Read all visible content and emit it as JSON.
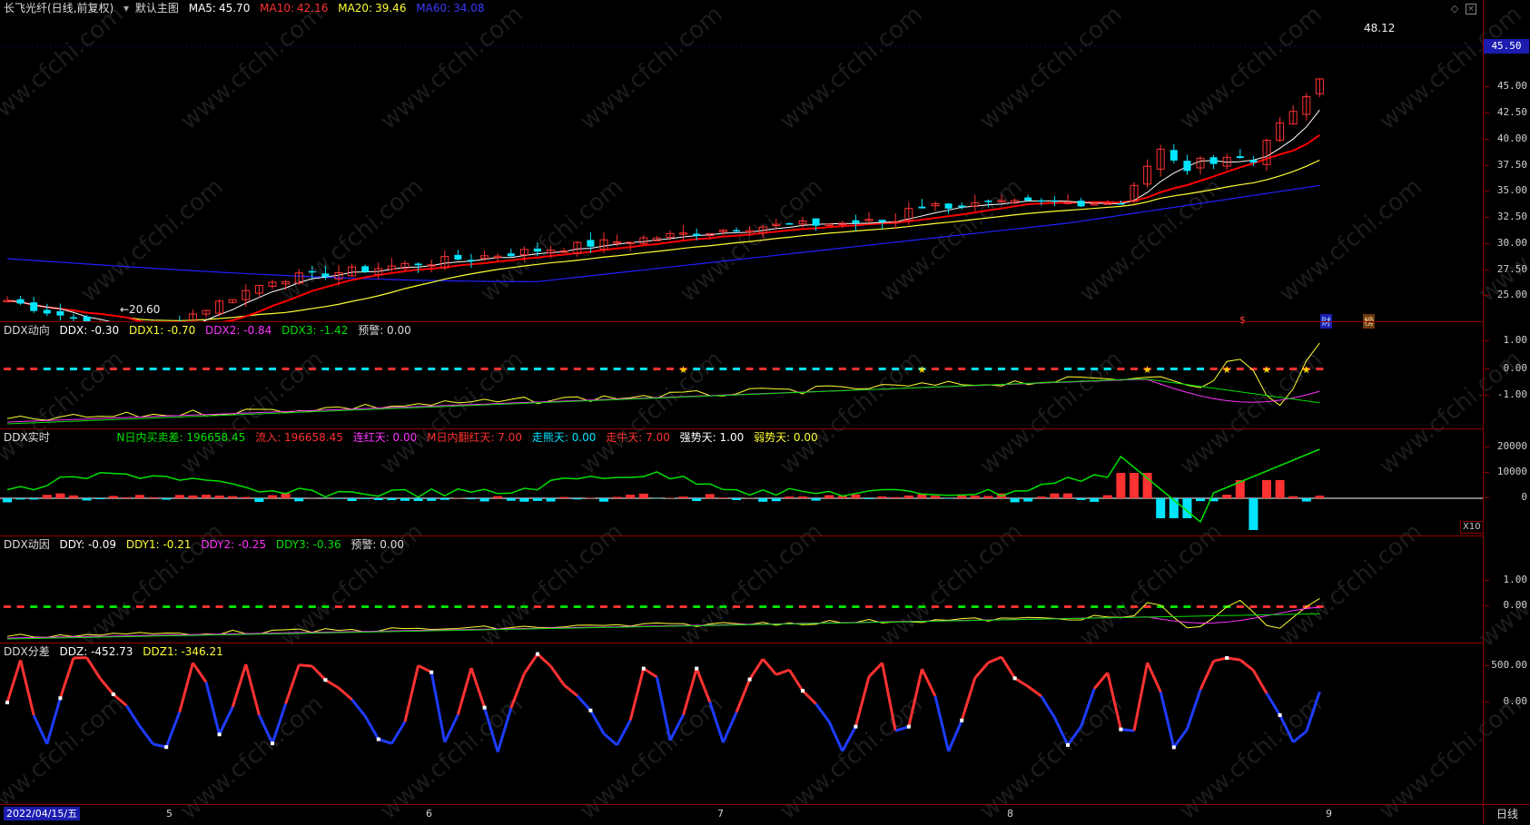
{
  "main_panel": {
    "stock_title": "长飞光纤(日线,前复权)",
    "view_label": "默认主图",
    "ma5_label": "MA5:",
    "ma5_value": "45.70",
    "ma10_label": "MA10:",
    "ma10_value": "42.16",
    "ma20_label": "MA20:",
    "ma20_value": "39.46",
    "ma60_label": "MA60:",
    "ma60_value": "34.08",
    "high_label": "48.12",
    "low_label": "←20.60",
    "current_price": "45.50",
    "axis_ticks": [
      "45.00",
      "42.50",
      "40.00",
      "37.50",
      "35.00",
      "32.50",
      "30.00",
      "27.50",
      "25.00"
    ],
    "event_markers": [
      {
        "text": "$"
      },
      {
        "text": "财"
      },
      {
        "text": "榜"
      }
    ]
  },
  "ddx_panel": {
    "title": "DDX动向",
    "ddx": "DDX: -0.30",
    "ddx1": "DDX1: -0.70",
    "ddx2": "DDX2: -0.84",
    "ddx3": "DDX3: -1.42",
    "warn": "预警: 0.00",
    "axis_ticks": [
      "1.00",
      "0.00",
      "-1.00"
    ]
  },
  "realtime_panel": {
    "title": "DDX实时",
    "f1": "N日内买卖差: 196658.45",
    "f2": "流入: 196658.45",
    "f3": "连红天: 0.00",
    "f4": "M日内翻红天: 7.00",
    "f5": "走熊天: 0.00",
    "f6": "走牛天: 7.00",
    "f7": "强势天: 1.00",
    "f8": "弱势天: 0.00",
    "axis_ticks": [
      "20000",
      "10000",
      "0"
    ],
    "unit_tag": "X10"
  },
  "ddy_panel": {
    "title": "DDX动因",
    "ddy": "DDY: -0.09",
    "ddy1": "DDY1: -0.21",
    "ddy2": "DDY2: -0.25",
    "ddy3": "DDY3: -0.36",
    "warn": "预警: 0.00",
    "axis_ticks": [
      "1.00",
      "0.00"
    ]
  },
  "ddz_panel": {
    "title": "DDX分差",
    "ddz": "DDZ: -452.73",
    "ddz1": "DDZ1: -346.21",
    "axis_ticks": [
      "500.00",
      "0.00"
    ]
  },
  "time_axis": {
    "date_box": "2022/04/15/五",
    "months": [
      "5",
      "6",
      "7",
      "8",
      "9"
    ],
    "period_button": "日线"
  },
  "watermark": "www.cfchi.com",
  "colors": {
    "up": "#ff3232",
    "down": "#00e5ff",
    "ma5": "#ffffff",
    "ma10": "#ff0000",
    "ma20": "#ffff33",
    "ma60": "#2020ff",
    "green": "#00e000",
    "magenta": "#ff33ff",
    "border": "#8b0000"
  }
}
